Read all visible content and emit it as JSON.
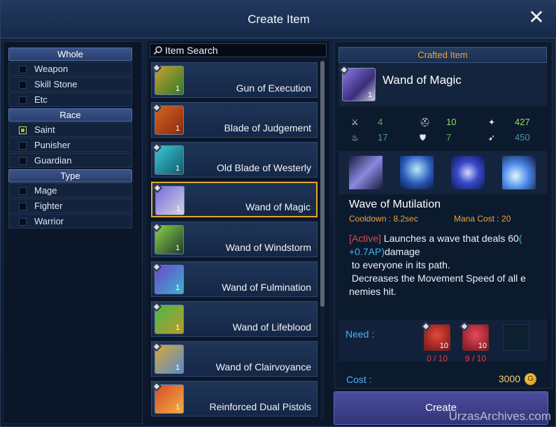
{
  "window": {
    "title": "Create Item",
    "close_glyph": "✕"
  },
  "filters": {
    "groups": [
      {
        "header": "Whole",
        "items": [
          {
            "label": "Weapon",
            "checked": false
          },
          {
            "label": "Skill Stone",
            "checked": false
          },
          {
            "label": "Etc",
            "checked": false
          }
        ]
      },
      {
        "header": "Race",
        "items": [
          {
            "label": "Saint",
            "checked": true
          },
          {
            "label": "Punisher",
            "checked": false
          },
          {
            "label": "Guardian",
            "checked": false
          }
        ]
      },
      {
        "header": "Type",
        "items": [
          {
            "label": "Mage",
            "checked": false
          },
          {
            "label": "Fighter",
            "checked": false
          },
          {
            "label": "Warrior",
            "checked": false
          }
        ]
      }
    ]
  },
  "search": {
    "placeholder": "Item Search",
    "icon": "search-icon"
  },
  "items": [
    {
      "name": "Gun of Execution",
      "qty": "1",
      "colors": [
        "#c9a12a",
        "#2e7a2e"
      ],
      "selected": false
    },
    {
      "name": "Blade of Judgement",
      "qty": "1",
      "colors": [
        "#d4641e",
        "#8a2a12"
      ],
      "selected": false
    },
    {
      "name": "Old Blade of Westerly",
      "qty": "1",
      "colors": [
        "#39c7d8",
        "#125a6a"
      ],
      "selected": false
    },
    {
      "name": "Wand of Magic",
      "qty": "1",
      "colors": [
        "#7a6ad8",
        "#d0d4e6"
      ],
      "selected": true
    },
    {
      "name": "Wand of Windstorm",
      "qty": "1",
      "colors": [
        "#8ad04a",
        "#1f3d28"
      ],
      "selected": false
    },
    {
      "name": "Wand of Fulmination",
      "qty": "1",
      "colors": [
        "#6a48c8",
        "#3fb0d0"
      ],
      "selected": false
    },
    {
      "name": "Wand of Lifeblood",
      "qty": "1",
      "colors": [
        "#4ab84a",
        "#b89a2a"
      ],
      "selected": false
    },
    {
      "name": "Wand of Clairvoyance",
      "qty": "1",
      "colors": [
        "#d8a83a",
        "#5a8ac8"
      ],
      "selected": false
    },
    {
      "name": "Reinforced Dual Pistols",
      "qty": "1",
      "colors": [
        "#d84a2a",
        "#f0b040"
      ],
      "selected": false
    }
  ],
  "detail": {
    "header": "Crafted Item",
    "item_name": "Wand of Magic",
    "item_qty": "1",
    "stats": [
      {
        "icon": "attack-icon",
        "value": "4",
        "color": "#5fb25f"
      },
      {
        "icon": "helmet-icon",
        "value": "10",
        "color": "#8fe065"
      },
      {
        "icon": "wand-icon",
        "value": "427",
        "color": "#8fe065"
      },
      {
        "icon": "fire-icon",
        "value": "17",
        "color": "#4f95a8"
      },
      {
        "icon": "shield-icon",
        "value": "7",
        "color": "#5fb25f"
      },
      {
        "icon": "boot-icon",
        "value": "450",
        "color": "#4f95a8"
      }
    ],
    "skill_icons": [
      "claw-wave-icon",
      "mage-figure-icon",
      "spiral-icon",
      "spirit-orb-icon"
    ],
    "skill_name": "Wave of Mutilation",
    "cooldown": "Cooldown : 8.2sec",
    "mana_cost": "Mana Cost : 20",
    "desc_active": "[Active]",
    "desc_part1": " Launches a wave that deals 60",
    "desc_ap": "(\n+0.7AP)",
    "desc_part2": "damage\n to everyone in its path.\n Decreases the Movement Speed of all e\nnemies hit.",
    "need_label": "Need :",
    "materials": [
      {
        "qty": "10",
        "count": "0 / 10"
      },
      {
        "qty": "10",
        "count": "9 / 10"
      }
    ],
    "cost_label": "Cost :",
    "cost_value": "3000",
    "coin_glyph": "G"
  },
  "create_button": "Create",
  "watermark": "UrzasArchives.com"
}
